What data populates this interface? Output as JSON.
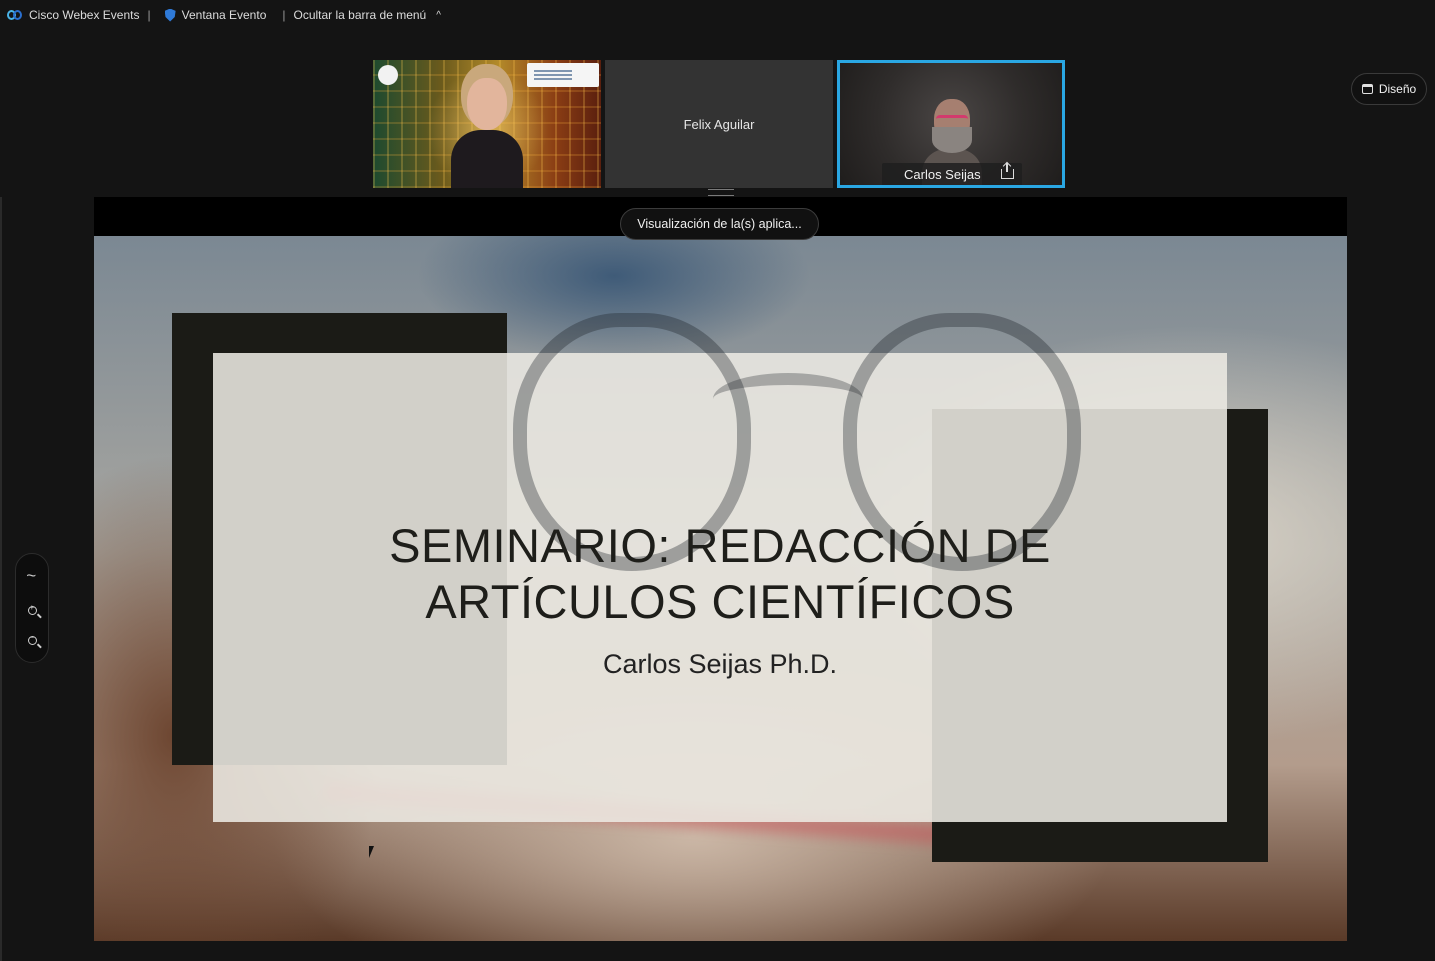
{
  "topbar": {
    "app_name": "Cisco Webex Events",
    "event_window": "Ventana Evento",
    "hide_menu": "Ocultar la barra de menú"
  },
  "participants": [
    {
      "name": "Felix Aguilar"
    },
    {
      "name": "Carlos Seijas"
    }
  ],
  "layout_button": {
    "label": "Diseño"
  },
  "share": {
    "pill_label": "Visualización de la(s) aplica..."
  },
  "slide": {
    "title_line1": "SEMINARIO: REDACCIÓN DE",
    "title_line2": "ARTÍCULOS CIENTÍFICOS",
    "subtitle": "Carlos Seijas Ph.D."
  },
  "colors": {
    "active_speaker_border": "#2aa7e3",
    "background": "#141414"
  }
}
